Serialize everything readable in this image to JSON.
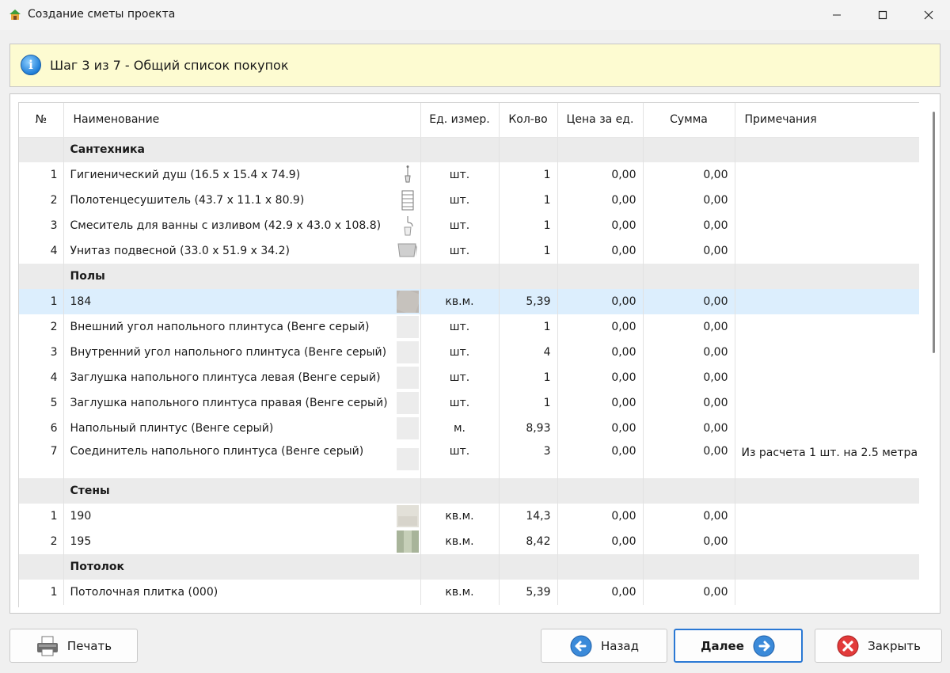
{
  "window": {
    "title": "Создание сметы проекта"
  },
  "banner": {
    "text": "Шаг 3 из 7 - Общий список покупок"
  },
  "table": {
    "headers": {
      "num": "№",
      "name": "Наименование",
      "unit": "Ед. измер.",
      "qty": "Кол-во",
      "price": "Цена за ед.",
      "sum": "Сумма",
      "notes": "Примечания"
    },
    "sections": [
      {
        "category": "Сантехника",
        "rows": [
          {
            "num": "1",
            "name": "Гигиенический душ (16.5 x 15.4 x 74.9)",
            "unit": "шт.",
            "qty": "1",
            "price": "0,00",
            "sum": "0,00",
            "note": "",
            "thumb": "shower-icon"
          },
          {
            "num": "2",
            "name": "Полотенцесушитель (43.7 x 11.1 x 80.9)",
            "unit": "шт.",
            "qty": "1",
            "price": "0,00",
            "sum": "0,00",
            "note": "",
            "thumb": "towel-dryer-icon"
          },
          {
            "num": "3",
            "name": "Смеситель для ванны с изливом (42.9 x 43.0 x 108.8)",
            "unit": "шт.",
            "qty": "1",
            "price": "0,00",
            "sum": "0,00",
            "note": "",
            "thumb": "faucet-icon"
          },
          {
            "num": "4",
            "name": "Унитаз подвесной (33.0 x 51.9 x 34.2)",
            "unit": "шт.",
            "qty": "1",
            "price": "0,00",
            "sum": "0,00",
            "note": "",
            "thumb": "toilet-icon"
          }
        ]
      },
      {
        "category": "Полы",
        "rows": [
          {
            "num": "1",
            "name": "184",
            "unit": "кв.м.",
            "qty": "5,39",
            "price": "0,00",
            "sum": "0,00",
            "note": "",
            "thumb": "floor-tile-swatch",
            "selected": true
          },
          {
            "num": "2",
            "name": "Внешний угол напольного плинтуса (Венге серый)",
            "unit": "шт.",
            "qty": "1",
            "price": "0,00",
            "sum": "0,00",
            "note": "",
            "thumb": "plinth-swatch"
          },
          {
            "num": "3",
            "name": "Внутренний угол напольного плинтуса (Венге серый)",
            "unit": "шт.",
            "qty": "4",
            "price": "0,00",
            "sum": "0,00",
            "note": "",
            "thumb": "plinth-swatch"
          },
          {
            "num": "4",
            "name": "Заглушка напольного плинтуса левая (Венге серый)",
            "unit": "шт.",
            "qty": "1",
            "price": "0,00",
            "sum": "0,00",
            "note": "",
            "thumb": "plinth-swatch"
          },
          {
            "num": "5",
            "name": "Заглушка напольного плинтуса правая (Венге серый)",
            "unit": "шт.",
            "qty": "1",
            "price": "0,00",
            "sum": "0,00",
            "note": "",
            "thumb": "plinth-swatch"
          },
          {
            "num": "6",
            "name": "Напольный плинтус (Венге серый)",
            "unit": "м.",
            "qty": "8,93",
            "price": "0,00",
            "sum": "0,00",
            "note": "",
            "thumb": "plinth-swatch"
          },
          {
            "num": "7",
            "name": "Соединитель напольного плинтуса (Венге серый)",
            "unit": "шт.",
            "qty": "3",
            "price": "0,00",
            "sum": "0,00",
            "note": "Из расчета 1 шт. на 2.5 метра",
            "thumb": "plinth-swatch"
          }
        ]
      },
      {
        "category": "Стены",
        "rows": [
          {
            "num": "1",
            "name": "190",
            "unit": "кв.м.",
            "qty": "14,3",
            "price": "0,00",
            "sum": "0,00",
            "note": "",
            "thumb": "wall-tile-swatch"
          },
          {
            "num": "2",
            "name": "195",
            "unit": "кв.м.",
            "qty": "8,42",
            "price": "0,00",
            "sum": "0,00",
            "note": "",
            "thumb": "wall-tile-green-swatch"
          }
        ]
      },
      {
        "category": "Потолок",
        "rows": [
          {
            "num": "1",
            "name": "Потолочная плитка (000)",
            "unit": "кв.м.",
            "qty": "5,39",
            "price": "0,00",
            "sum": "0,00",
            "note": "",
            "thumb": ""
          }
        ]
      }
    ]
  },
  "buttons": {
    "print": "Печать",
    "back": "Назад",
    "next": "Далее",
    "close": "Закрыть"
  },
  "colors": {
    "banner_bg": "#fdfbd1",
    "selected_row": "#dceefd",
    "category_row": "#ebebeb",
    "default_button_border": "#2a78d4"
  }
}
